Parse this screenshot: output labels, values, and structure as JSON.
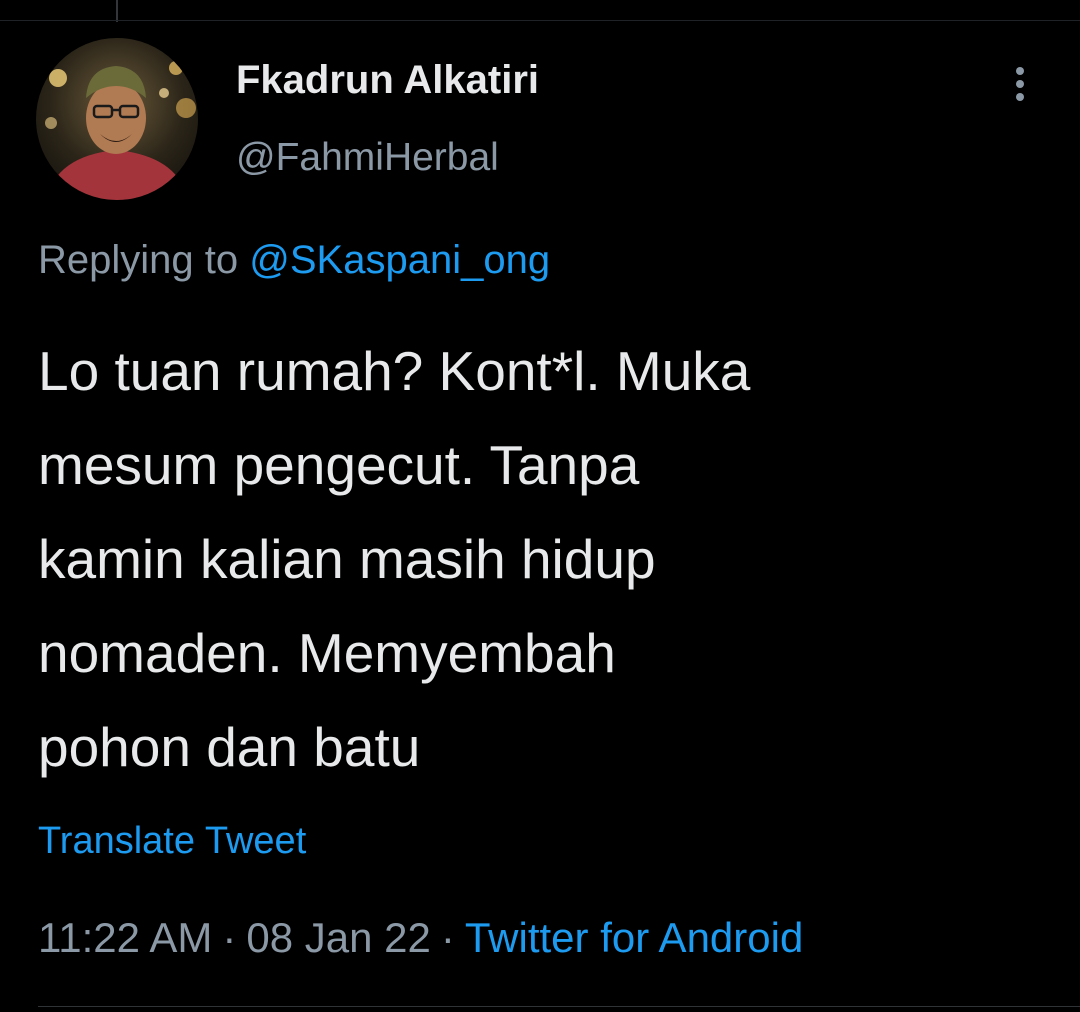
{
  "tweet": {
    "author": {
      "display_name": "Fkadrun Alkatiri",
      "handle": "@FahmiHerbal",
      "avatar": "profile-photo"
    },
    "more_icon": "more-vertical-icon",
    "replying_prefix": "Replying to",
    "replying_to": "@SKaspani_ong",
    "text": "Lo tuan rumah? Kont*l. Muka\nmesum  pengecut. Tanpa\nkamin kalian masih hidup\nnomaden. Memyembah\npohon dan batu",
    "translate_label": "Translate Tweet",
    "time": "11:22 AM",
    "separator": "·",
    "date": "08 Jan 22",
    "source": "Twitter for Android"
  },
  "colors": {
    "background": "#000000",
    "text_primary": "#e7e9ea",
    "text_secondary": "#8b98a5",
    "link": "#1d9bf0"
  }
}
